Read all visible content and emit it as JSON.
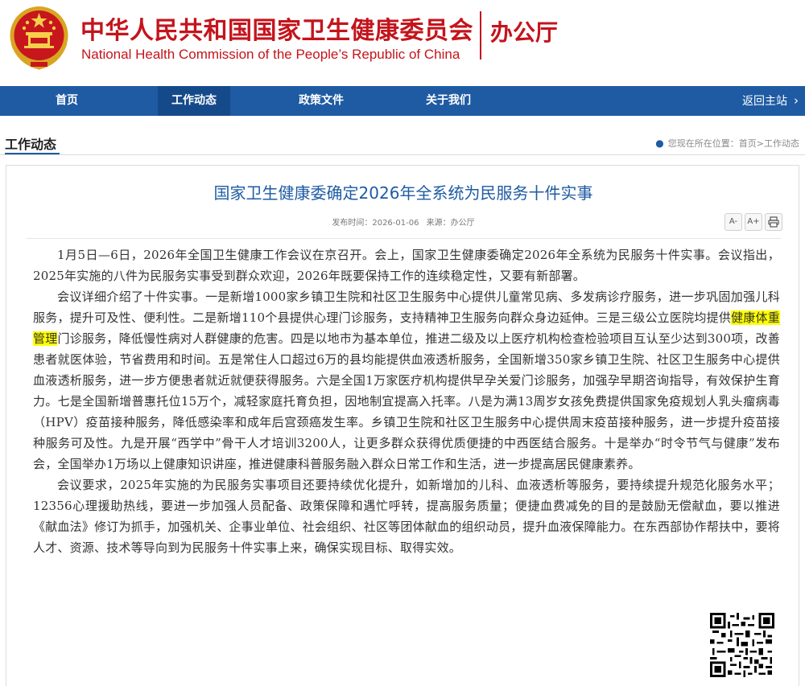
{
  "header": {
    "org_cn": "中华人民共和国国家卫生健康委员会",
    "org_en": "National Health Commission of the People’s  Republic of China",
    "office": "办公厅"
  },
  "nav": {
    "items": [
      {
        "label": "首页"
      },
      {
        "label": "工作动态"
      },
      {
        "label": "政策文件"
      },
      {
        "label": "关于我们"
      }
    ],
    "back_label": "返回主站"
  },
  "section": {
    "title": "工作动态",
    "breadcrumb_prefix": "您现在所在位置：",
    "breadcrumb_home": "首页",
    "breadcrumb_sep": ">",
    "breadcrumb_current": "工作动态"
  },
  "article": {
    "title": "国家卫生健康委确定2026年全系统为民服务十件实事",
    "publish_label": "发布时间：",
    "publish_date": "2026-01-06",
    "source_label": "来源：",
    "source": "办公厅",
    "tools": {
      "font_smaller": "A-",
      "font_larger": "A+"
    },
    "paragraphs": {
      "p1": "1月5日—6日，2026年全国卫生健康工作会议在京召开。会上，国家卫生健康委确定2026年全系统为民服务十件实事。会议指出，2025年实施的八件为民服务实事受到群众欢迎，2026年既要保持工作的连续稳定性，又要有新部署。",
      "p2_before": "会议详细介绍了十件实事。一是新增1000家乡镇卫生院和社区卫生服务中心提供儿童常见病、多发病诊疗服务，进一步巩固加强儿科服务，提升可及性、便利性。二是新增110个县提供心理门诊服务，支持精神卫生服务向群众身边延伸。三是三级公立医院均提供",
      "p2_highlight": "健康体重管理",
      "p2_after": "门诊服务，降低慢性病对人群健康的危害。四是以地市为基本单位，推进二级及以上医疗机构检查检验项目互认至少达到300项，改善患者就医体验，节省费用和时间。五是常住人口超过6万的县均能提供血液透析服务，全国新增350家乡镇卫生院、社区卫生服务中心提供血液透析服务，进一步方便患者就近就便获得服务。六是全国1万家医疗机构提供早孕关爱门诊服务，加强孕早期咨询指导，有效保护生育力。七是全国新增普惠托位15万个，减轻家庭托育负担，因地制宜提高入托率。八是为满13周岁女孩免费提供国家免疫规划人乳头瘤病毒（HPV）疫苗接种服务，降低感染率和成年后宫颈癌发生率。乡镇卫生院和社区卫生服务中心提供周末疫苗接种服务，进一步提升疫苗接种服务可及性。九是开展“西学中”骨干人才培训3200人，让更多群众获得优质便捷的中西医结合服务。十是举办“时令节气与健康”发布会，全国举办1万场以上健康知识讲座，推进健康科普服务融入群众日常工作和生活，进一步提高居民健康素养。",
      "p3": "会议要求，2025年实施的为民服务实事项目还要持续优化提升，如新增加的儿科、血液透析等服务，要持续提升规范化服务水平；12356心理援助热线，要进一步加强人员配备、政策保障和遇忙呼转，提高服务质量；便捷血费减免的目的是鼓励无偿献血，要以推进《献血法》修订为抓手，加强机关、企事业单位、社会组织、社区等团体献血的组织动员，提升血液保障能力。在东西部协作帮扶中，要将人才、资源、技术等导向到为民服务十件实事上来，确保实现目标、取得实效。"
    }
  },
  "colors": {
    "brand_red": "#c4141c",
    "nav_blue": "#1e5ba3",
    "title_blue": "#1e5ba3",
    "highlight": "#ffff00"
  },
  "icons": [
    "national-emblem-icon",
    "location-pin-icon",
    "chevron-right-icon",
    "print-icon",
    "qr-code-icon"
  ]
}
